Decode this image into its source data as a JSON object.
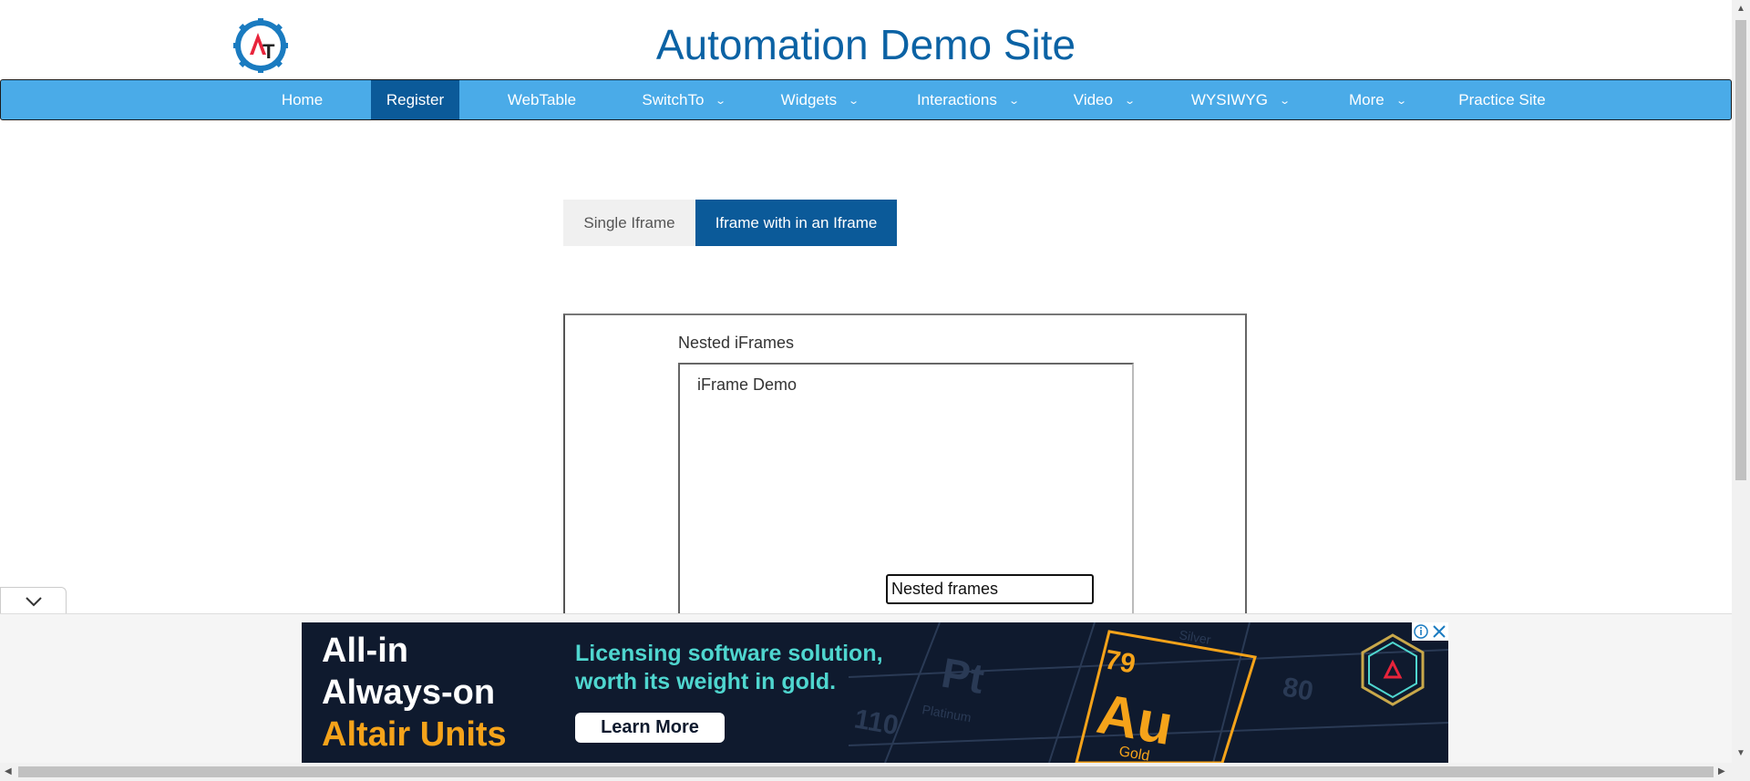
{
  "header": {
    "title": "Automation Demo Site",
    "logo_text": "AT"
  },
  "nav": {
    "items": [
      {
        "label": "Home",
        "has_dropdown": false,
        "active": false
      },
      {
        "label": "Register",
        "has_dropdown": false,
        "active": true
      },
      {
        "label": "WebTable",
        "has_dropdown": false,
        "active": false
      },
      {
        "label": "SwitchTo",
        "has_dropdown": true,
        "active": false
      },
      {
        "label": "Widgets",
        "has_dropdown": true,
        "active": false
      },
      {
        "label": "Interactions",
        "has_dropdown": true,
        "active": false
      },
      {
        "label": "Video",
        "has_dropdown": true,
        "active": false
      },
      {
        "label": "WYSIWYG",
        "has_dropdown": true,
        "active": false
      },
      {
        "label": "More",
        "has_dropdown": true,
        "active": false
      },
      {
        "label": "Practice Site",
        "has_dropdown": false,
        "active": false
      }
    ],
    "chevron_icon": "chevron-down-icon"
  },
  "tabs": {
    "single": "Single Iframe",
    "nested": "Iframe with in an Iframe",
    "active": "nested"
  },
  "outer_frame": {
    "label": "Nested iFrames"
  },
  "inner_frame": {
    "label": "iFrame Demo",
    "input_value": "Nested frames"
  },
  "ad": {
    "headline": [
      "All-in",
      "Always-on",
      "Altair Units"
    ],
    "tagline": [
      "Licensing software solution,",
      "worth its weight in gold."
    ],
    "cta": "Learn More",
    "element_number": "79",
    "element_symbol": "Au",
    "element_name": "Gold",
    "neighbor_text": [
      "Pt",
      "Platinum",
      "Silver",
      "80",
      "110"
    ],
    "colors": {
      "background": "#0f1a2e",
      "accent": "#f5a31a",
      "tagline": "#4fd6cf"
    }
  },
  "colors": {
    "nav_bg": "#4aabe8",
    "nav_active": "#0b5a99",
    "title": "#0b62a4"
  }
}
